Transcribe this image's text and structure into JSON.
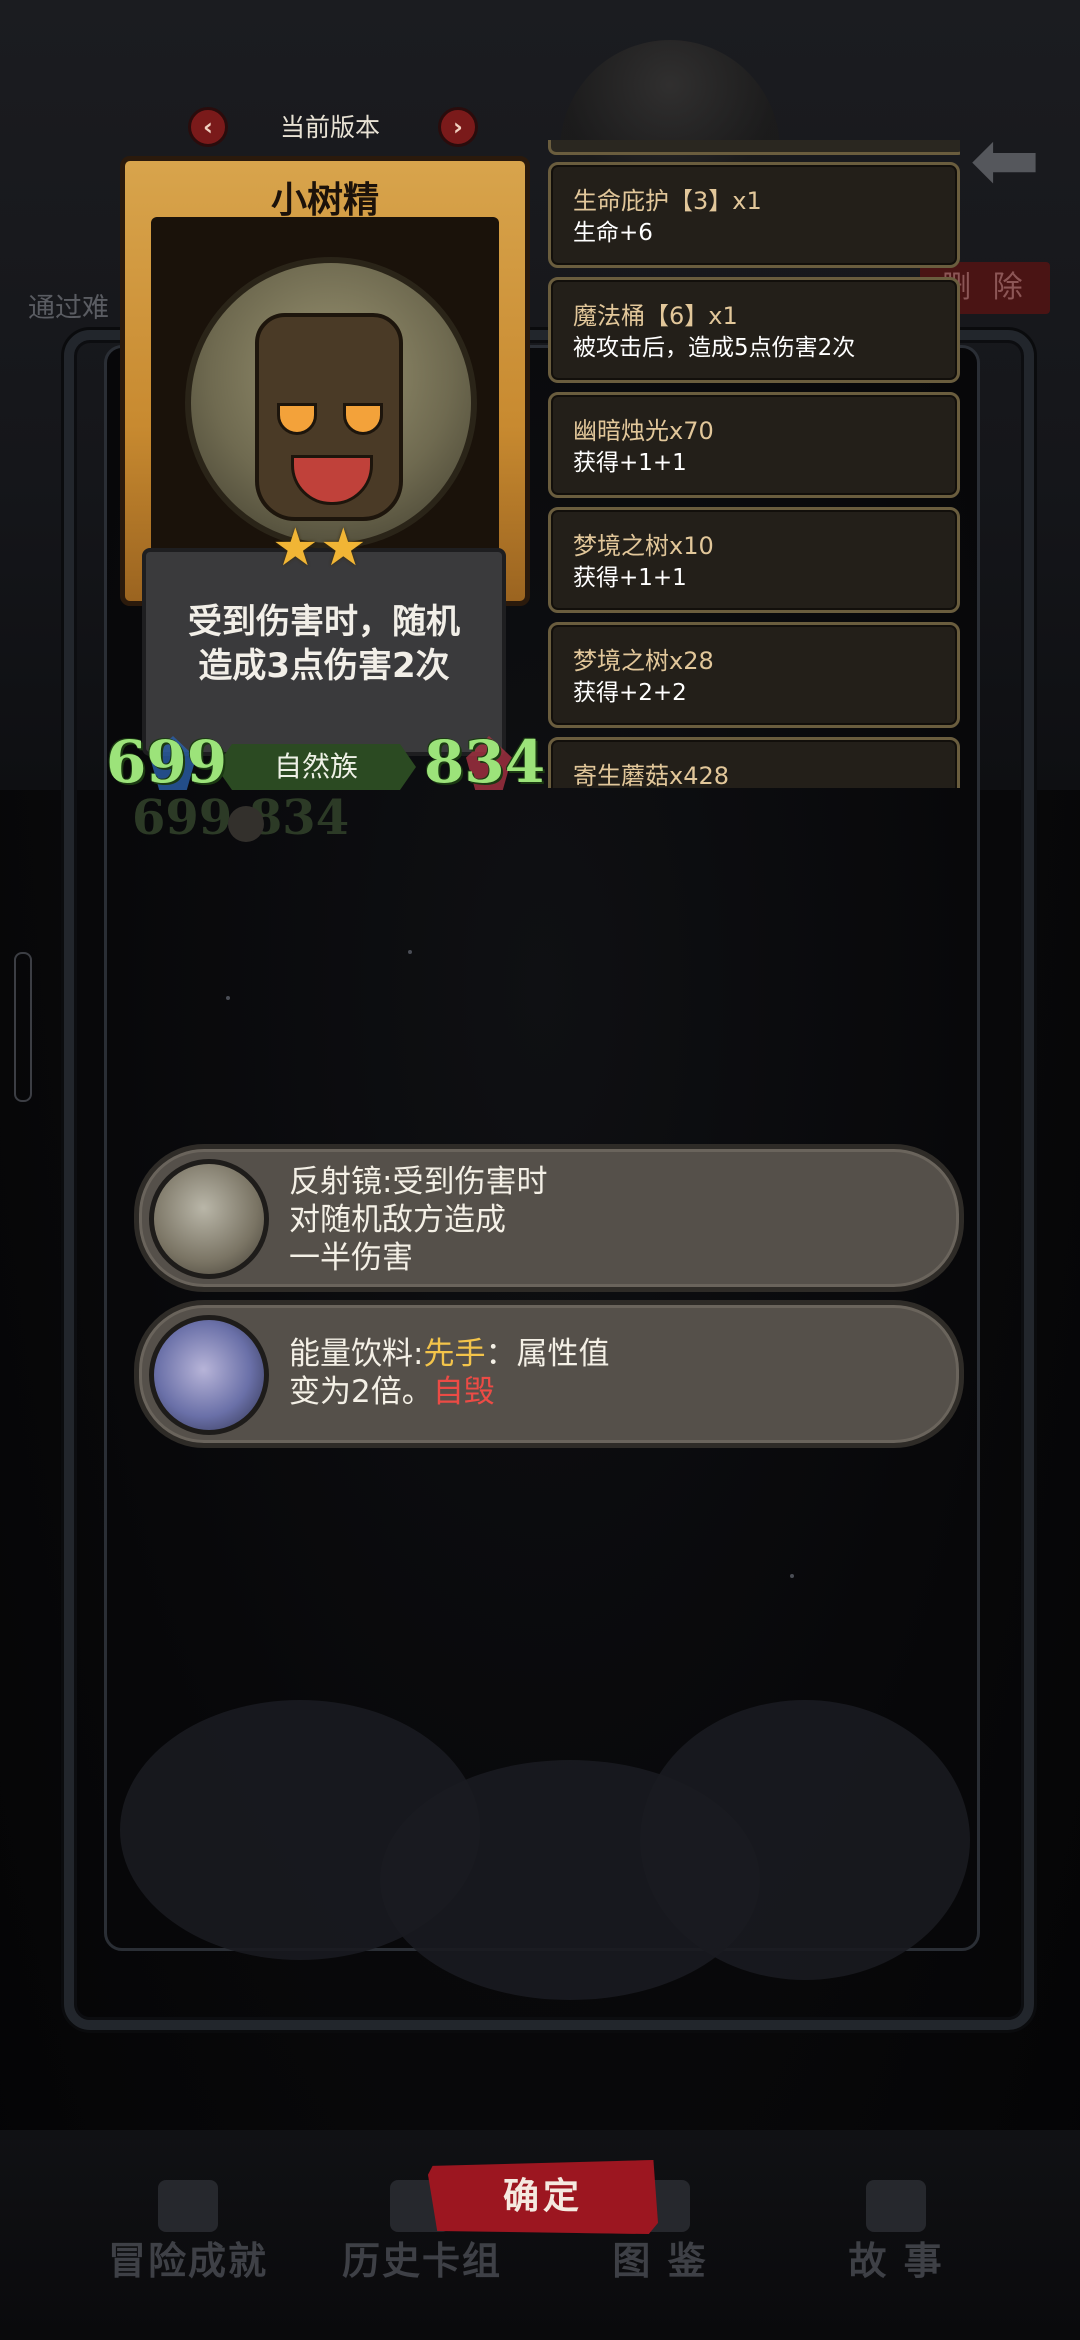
{
  "background": {
    "left_label": "通过难",
    "delete_label": "删 除"
  },
  "version": {
    "label": "当前版本",
    "prev": "‹",
    "next": "›"
  },
  "card": {
    "title": "小树精",
    "stars": [
      "★",
      "★"
    ],
    "description_line1": "受到伤害时，随机",
    "description_line2": "造成3点伤害2次",
    "race": "自然族",
    "attack": "699",
    "health": "834"
  },
  "ghost_stats": "699  834",
  "effects": [
    {
      "name": "生命庇护【3】x1",
      "desc": "生命+6"
    },
    {
      "name": "魔法桶【6】x1",
      "desc": "被攻击后，造成5点伤害2次"
    },
    {
      "name": "幽暗烛光x70",
      "desc": "获得+1+1"
    },
    {
      "name": "梦境之树x10",
      "desc": "获得+1+1"
    },
    {
      "name": "梦境之树x28",
      "desc": "获得+2+2"
    },
    {
      "name": "寄生蘑菇x428",
      "desc": ""
    }
  ],
  "relics": [
    {
      "icon": "mirror-icon",
      "line1": "反射镜:受到伤害时",
      "line2": "对随机敌方造成",
      "line3": "一半伤害"
    },
    {
      "icon": "energy-drink-icon",
      "prefix": "能量饮料:",
      "highlight1": "先手",
      "middle": "：属性值",
      "line2_prefix": "变为2倍。",
      "highlight2": "自毁"
    }
  ],
  "confirm_label": "确定",
  "bottom_nav": [
    "冒险成就",
    "历史卡组",
    "图 鉴",
    "故 事"
  ],
  "colors": {
    "accent_red": "#9c1620",
    "stat_green": "#9ce37a",
    "highlight_yellow": "#f3c44a",
    "highlight_red": "#ec4b45"
  }
}
